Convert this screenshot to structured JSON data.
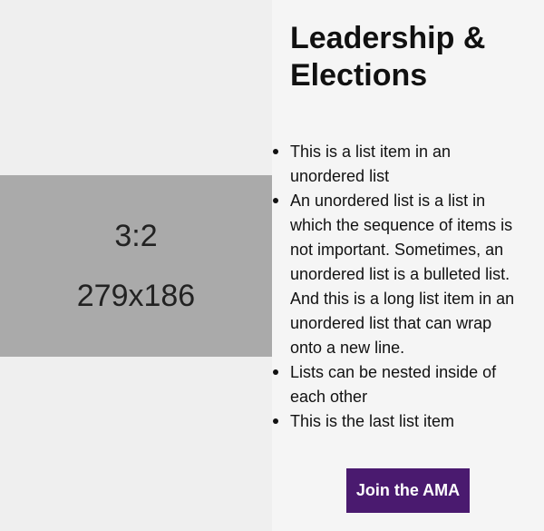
{
  "image_placeholder": {
    "ratio": "3:2",
    "size": "279x186"
  },
  "content": {
    "title": "Leadership & Elections",
    "list_items": [
      "This is a list item in an unordered list",
      "An unordered list is a list in which the sequence of items is not important. Sometimes, an unordered list is a bulleted list. And this is a long list item in an unordered list that can wrap onto a new line.",
      "Lists can be nested inside of each other",
      "This is the last list item"
    ],
    "button_label": "Join the AMA"
  },
  "colors": {
    "left_background": "#efefef",
    "right_background": "#f5f5f5",
    "placeholder": "#aaaaaa",
    "button": "#4a1a6f",
    "button_text": "#ffffff"
  },
  "icons": {
    "list_marker": "bullet-icon"
  }
}
